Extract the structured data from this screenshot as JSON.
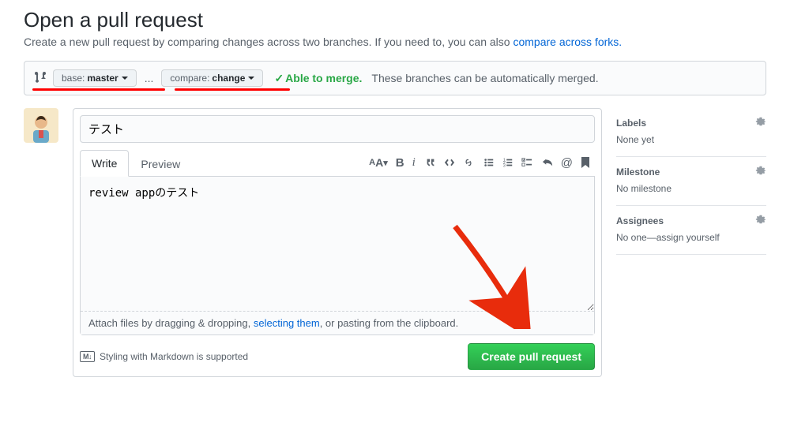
{
  "header": {
    "title": "Open a pull request",
    "subtitle_pre": "Create a new pull request by comparing changes across two branches. If you need to, you can also ",
    "subtitle_link": "compare across forks."
  },
  "compare": {
    "base_label": "base:",
    "base_value": "master",
    "dots": "...",
    "compare_label": "compare:",
    "compare_value": "change",
    "merge_status": "Able to merge.",
    "merge_note": "These branches can be automatically merged."
  },
  "form": {
    "title_value": "テスト",
    "tab_write": "Write",
    "tab_preview": "Preview",
    "body_value": "review appのテスト",
    "attach_pre": "Attach files by dragging & dropping, ",
    "attach_link": "selecting them",
    "attach_post": ", or pasting from the clipboard.",
    "md_hint": "Styling with Markdown is supported",
    "submit_label": "Create pull request"
  },
  "sidebar": {
    "labels": {
      "title": "Labels",
      "body": "None yet"
    },
    "milestone": {
      "title": "Milestone",
      "body": "No milestone"
    },
    "assignees": {
      "title": "Assignees",
      "body_pre": "No one—",
      "body_link": "assign yourself"
    }
  }
}
